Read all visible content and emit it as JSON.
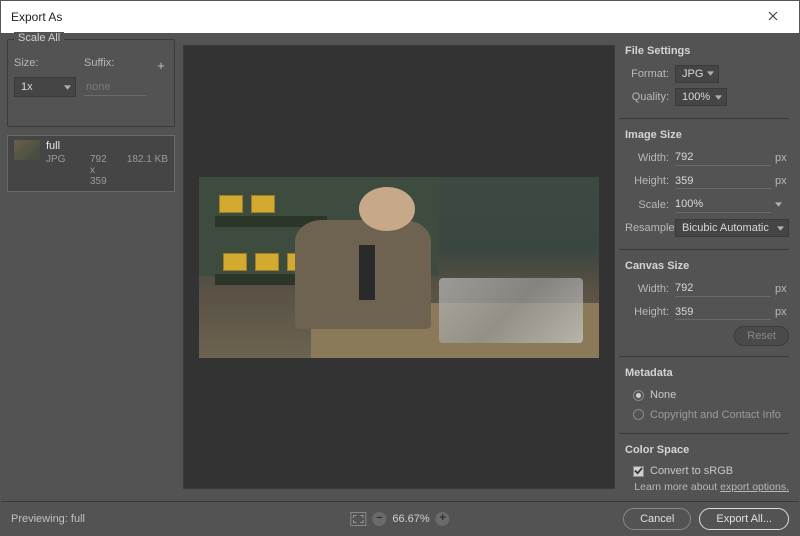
{
  "dialog": {
    "title": "Export As"
  },
  "left": {
    "scale_all_title": "Scale All",
    "size_label": "Size:",
    "suffix_label": "Suffix:",
    "size_value": "1x",
    "suffix_placeholder": "none",
    "asset": {
      "name": "full",
      "format": "JPG",
      "dimensions": "792 x 359",
      "filesize": "182.1 KB"
    }
  },
  "right": {
    "file_settings_title": "File Settings",
    "format_label": "Format:",
    "format_value": "JPG",
    "quality_label": "Quality:",
    "quality_value": "100%",
    "image_size_title": "Image Size",
    "width_label": "Width:",
    "height_label": "Height:",
    "scale_label": "Scale:",
    "resample_label": "Resample:",
    "img_width": "792",
    "img_height": "359",
    "scale_value": "100%",
    "resample_value": "Bicubic Automatic",
    "px": "px",
    "canvas_size_title": "Canvas Size",
    "canvas_width": "792",
    "canvas_height": "359",
    "reset_label": "Reset",
    "metadata_title": "Metadata",
    "radio_none": "None",
    "radio_copyright": "Copyright and Contact Info",
    "color_space_title": "Color Space",
    "convert_srgb": "Convert to sRGB",
    "learn_more_prefix": "Learn more about ",
    "learn_more_link": "export options."
  },
  "footer": {
    "previewing_prefix": "Previewing: ",
    "previewing_name": "full",
    "zoom_value": "66.67%",
    "cancel": "Cancel",
    "export_all": "Export All..."
  }
}
